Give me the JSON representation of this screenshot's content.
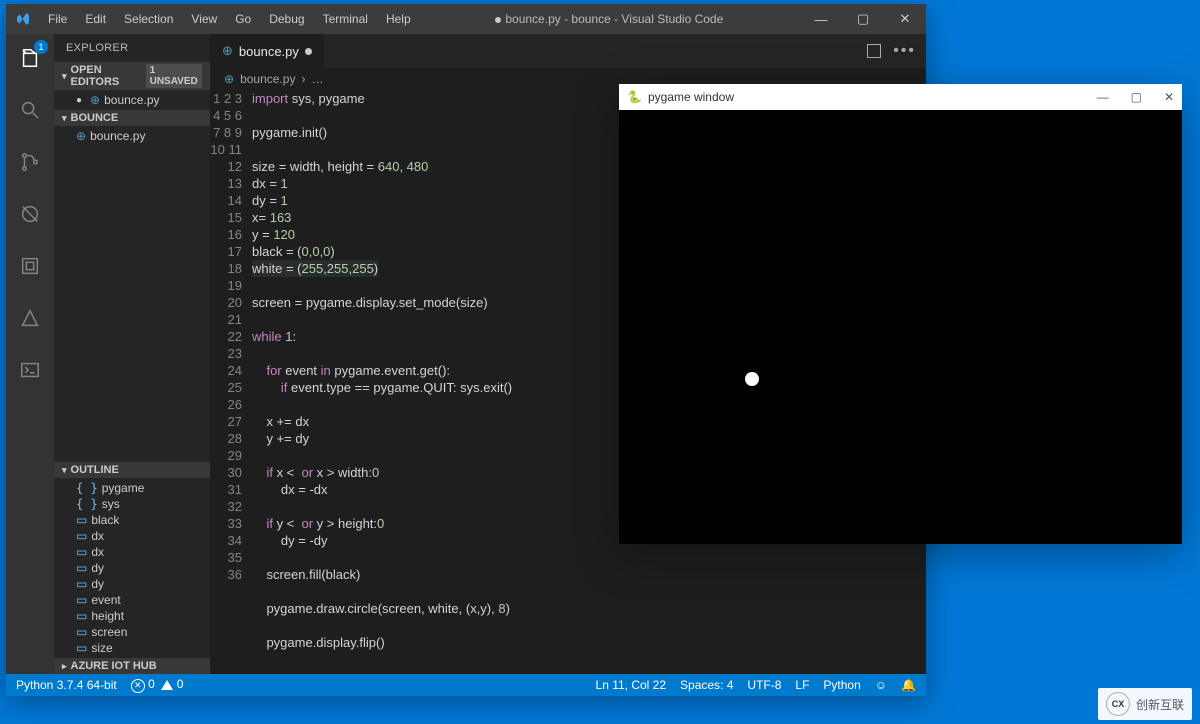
{
  "window_title": "bounce.py - bounce - Visual Studio Code",
  "modified_indicator": true,
  "menu": [
    "File",
    "Edit",
    "Selection",
    "View",
    "Go",
    "Debug",
    "Terminal",
    "Help"
  ],
  "activity_bar": {
    "badge": "1"
  },
  "sidebar": {
    "header": "EXPLORER",
    "open_editors": {
      "label": "OPEN EDITORS",
      "badge": "1 UNSAVED",
      "items": [
        {
          "icon": "python",
          "label": "bounce.py",
          "modified": true
        }
      ]
    },
    "folder": {
      "label": "BOUNCE",
      "items": [
        {
          "icon": "python",
          "label": "bounce.py"
        }
      ]
    },
    "outline": {
      "label": "OUTLINE",
      "items": [
        {
          "icon": "brace",
          "label": "pygame"
        },
        {
          "icon": "brace",
          "label": "sys"
        },
        {
          "icon": "pill",
          "label": "black"
        },
        {
          "icon": "pill",
          "label": "dx"
        },
        {
          "icon": "pill",
          "label": "dx"
        },
        {
          "icon": "pill",
          "label": "dy"
        },
        {
          "icon": "pill",
          "label": "dy"
        },
        {
          "icon": "pill",
          "label": "event"
        },
        {
          "icon": "pill",
          "label": "height"
        },
        {
          "icon": "pill",
          "label": "screen"
        },
        {
          "icon": "pill",
          "label": "size"
        }
      ]
    },
    "azure": {
      "label": "AZURE IOT HUB"
    }
  },
  "tabs": [
    {
      "icon": "python",
      "label": "bounce.py",
      "modified": true,
      "active": true
    }
  ],
  "breadcrumb": {
    "file": "bounce.py",
    "rest": "…"
  },
  "code": {
    "first_line": 1,
    "last_line": 36,
    "cursor_line": 11,
    "lines": [
      {
        "kw": [
          "import"
        ],
        "plain": " sys, pygame"
      },
      {
        "plain": ""
      },
      {
        "plain": "pygame.init()"
      },
      {
        "plain": ""
      },
      {
        "plain": "size = width, height = ",
        "nums": "640, 480"
      },
      {
        "plain": "dx = ",
        "nums": "1"
      },
      {
        "plain": "dy = ",
        "nums": "1"
      },
      {
        "plain": "x= ",
        "nums": "163"
      },
      {
        "plain": "y = ",
        "nums": "120"
      },
      {
        "plain": "black = (",
        "nums": "0,0,0",
        "after": ")"
      },
      {
        "plain": "white = (",
        "nums": "255,255,255",
        "after": ")",
        "hl": true
      },
      {
        "plain": ""
      },
      {
        "plain": "screen = pygame.display.set_mode(size)"
      },
      {
        "plain": ""
      },
      {
        "kw": [
          "while"
        ],
        "plain": " ",
        "nums": "1",
        "after": ":"
      },
      {
        "plain": ""
      },
      {
        "indent": "    ",
        "kw": [
          "for"
        ],
        "mid": " event ",
        "kw2": [
          "in"
        ],
        "plain": " pygame.event.get():"
      },
      {
        "indent": "        ",
        "kw": [
          "if"
        ],
        "plain": " event.type == pygame.QUIT: sys.exit()"
      },
      {
        "plain": ""
      },
      {
        "indent": "    ",
        "plain": "x += dx"
      },
      {
        "indent": "    ",
        "plain": "y += dy"
      },
      {
        "plain": ""
      },
      {
        "indent": "    ",
        "kw": [
          "if"
        ],
        "mid": " x < ",
        "nums": "0",
        "kw2": [
          " or"
        ],
        "plain": " x > width:"
      },
      {
        "indent": "        ",
        "plain": "dx = -dx"
      },
      {
        "plain": ""
      },
      {
        "indent": "    ",
        "kw": [
          "if"
        ],
        "mid": " y < ",
        "nums": "0",
        "kw2": [
          " or"
        ],
        "plain": " y > height:"
      },
      {
        "indent": "        ",
        "plain": "dy = -dy"
      },
      {
        "plain": ""
      },
      {
        "indent": "    ",
        "plain": "screen.fill(black)"
      },
      {
        "plain": ""
      },
      {
        "indent": "    ",
        "plain": "pygame.draw.circle(screen, white, (x,y), ",
        "nums": "8",
        "after": ")"
      },
      {
        "plain": ""
      },
      {
        "indent": "    ",
        "plain": "pygame.display.flip()"
      },
      {
        "plain": ""
      },
      {
        "plain": ""
      },
      {
        "plain": ""
      }
    ]
  },
  "status": {
    "left": {
      "python": "Python 3.7.4 64-bit",
      "errors": "0",
      "warnings": "0"
    },
    "right": {
      "pos": "Ln 11, Col 22",
      "spaces": "Spaces: 4",
      "enc": "UTF-8",
      "eol": "LF",
      "lang": "Python"
    }
  },
  "pygame_window": {
    "title": "pygame window"
  },
  "watermark": {
    "text": "创新互联"
  }
}
